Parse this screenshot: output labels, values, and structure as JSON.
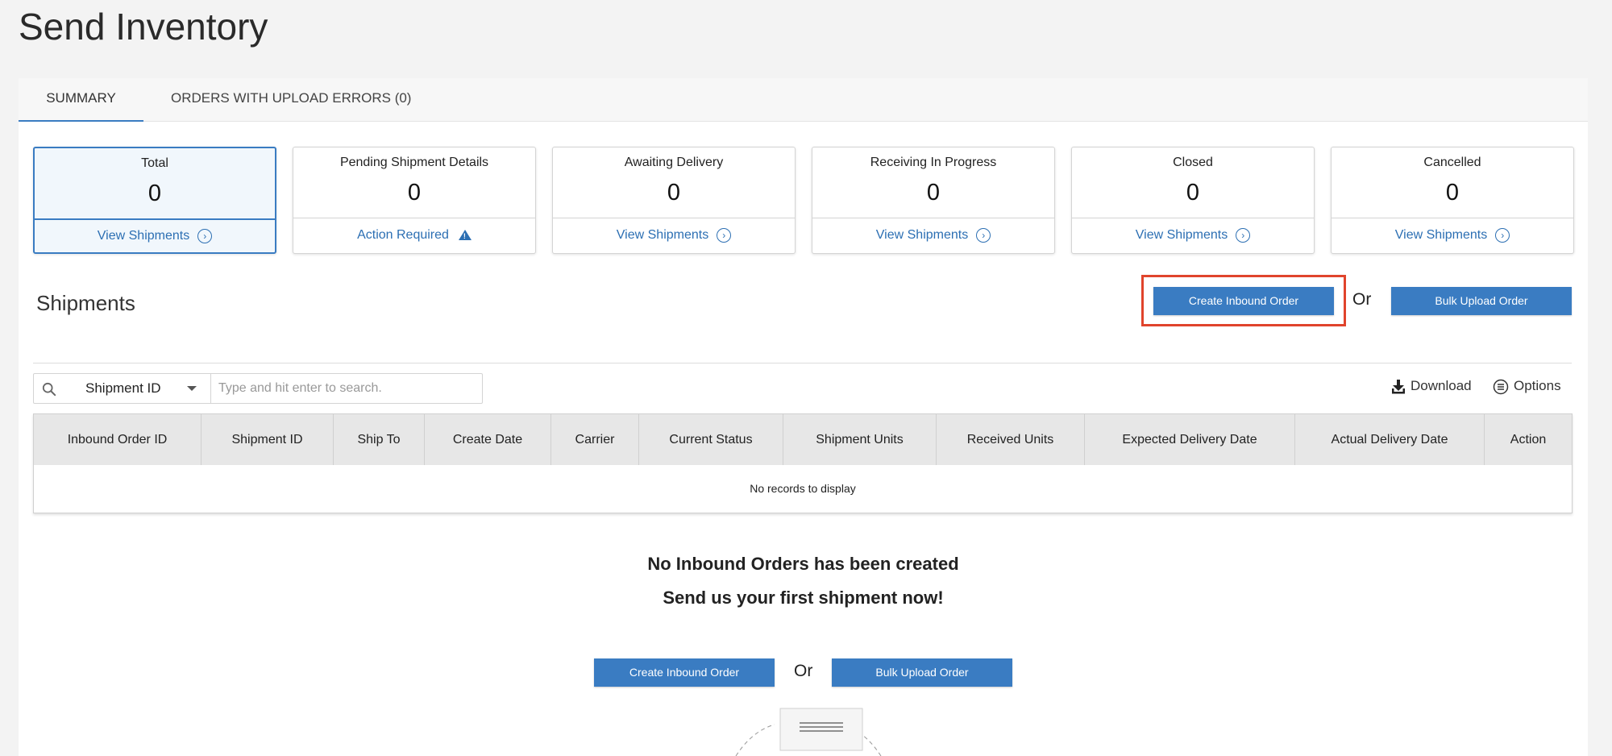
{
  "page": {
    "title": "Send Inventory"
  },
  "tabs": [
    {
      "label": "SUMMARY",
      "active": true
    },
    {
      "label": "ORDERS WITH UPLOAD ERRORS (0)",
      "active": false
    }
  ],
  "cards": [
    {
      "title": "Total",
      "count": "0",
      "link": "View Shipments",
      "link_icon": "chevron-circle-icon",
      "active": true
    },
    {
      "title": "Pending Shipment Details",
      "count": "0",
      "link": "Action Required",
      "link_icon": "warning-icon",
      "active": false
    },
    {
      "title": "Awaiting Delivery",
      "count": "0",
      "link": "View Shipments",
      "link_icon": "chevron-circle-icon",
      "active": false
    },
    {
      "title": "Receiving In Progress",
      "count": "0",
      "link": "View Shipments",
      "link_icon": "chevron-circle-icon",
      "active": false
    },
    {
      "title": "Closed",
      "count": "0",
      "link": "View Shipments",
      "link_icon": "chevron-circle-icon",
      "active": false
    },
    {
      "title": "Cancelled",
      "count": "0",
      "link": "View Shipments",
      "link_icon": "chevron-circle-icon",
      "active": false
    }
  ],
  "shipments": {
    "title": "Shipments",
    "create_label": "Create Inbound Order",
    "or_label": "Or",
    "bulk_label": "Bulk Upload Order"
  },
  "search": {
    "filter_value": "Shipment ID",
    "placeholder": "Type and hit enter to search."
  },
  "toolbar": {
    "download_label": "Download",
    "options_label": "Options"
  },
  "table": {
    "columns": [
      "Inbound Order ID",
      "Shipment ID",
      "Ship To",
      "Create Date",
      "Carrier",
      "Current Status",
      "Shipment Units",
      "Received Units",
      "Expected Delivery Date",
      "Actual Delivery Date",
      "Action"
    ],
    "empty_text": "No records to display"
  },
  "empty_state": {
    "title": "No Inbound Orders has been created",
    "subtitle": "Send us your first shipment now!",
    "create_label": "Create Inbound Order",
    "or_label": "Or",
    "bulk_label": "Bulk Upload Order"
  },
  "colors": {
    "accent": "#3a7cc2",
    "link": "#2c6fb3",
    "highlight_box": "#e0442c",
    "table_header_bg": "#e7e7e7"
  }
}
